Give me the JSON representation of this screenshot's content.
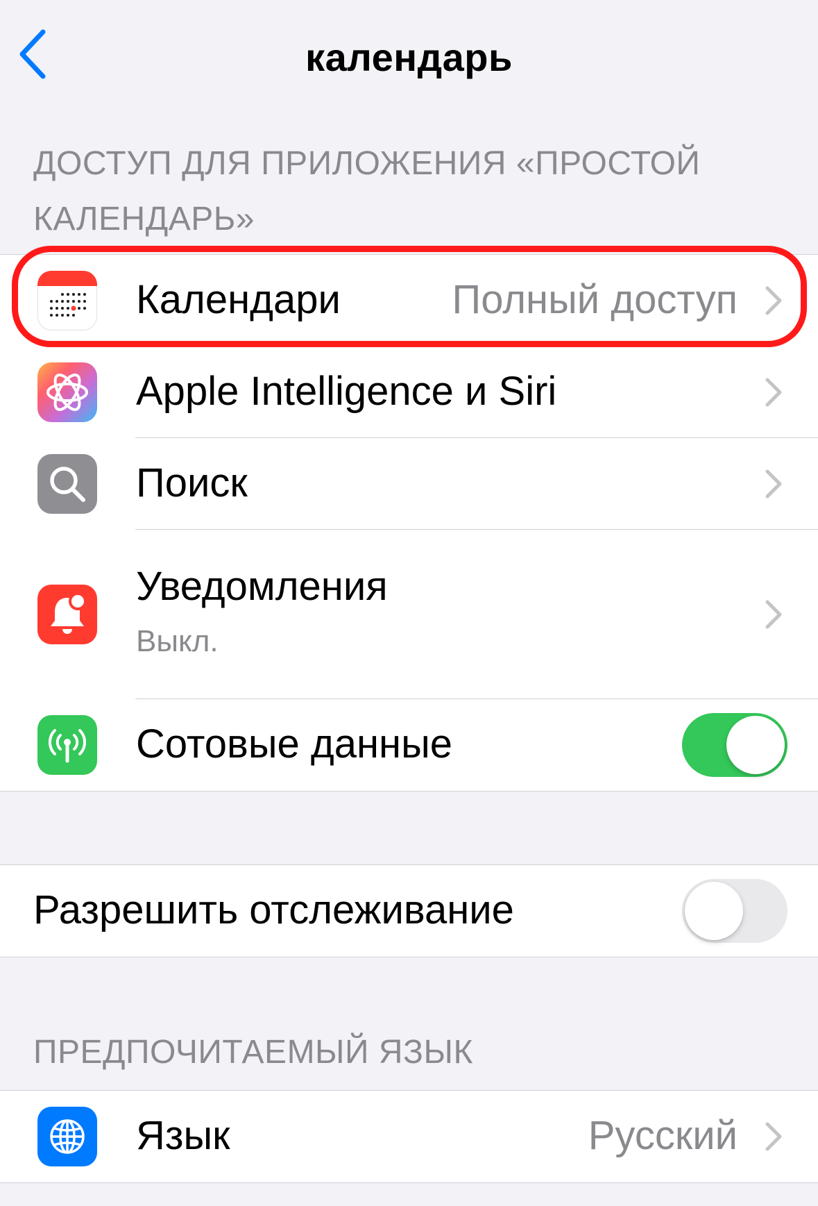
{
  "nav": {
    "title": "календарь",
    "back_icon": "chevron-left-icon"
  },
  "sections": {
    "access_header": "ДОСТУП ДЛЯ ПРИЛОЖЕНИЯ «ПРОСТОЙ КАЛЕНДАРЬ»",
    "language_header": "ПРЕДПОЧИТАЕМЫЙ ЯЗЫК"
  },
  "access": {
    "calendars": {
      "label": "Календари",
      "value": "Полный доступ",
      "icon": "calendar-app-icon"
    },
    "siri": {
      "label": "Apple Intelligence и Siri",
      "icon": "apple-intelligence-icon"
    },
    "search": {
      "label": "Поиск",
      "icon": "search-icon"
    },
    "notifications": {
      "label": "Уведомления",
      "sub": "Выкл.",
      "icon": "notification-bell-icon"
    },
    "cellular": {
      "label": "Сотовые данные",
      "icon": "cellular-antenna-icon",
      "enabled": true
    }
  },
  "tracking": {
    "label": "Разрешить отслеживание",
    "enabled": false
  },
  "language": {
    "label": "Язык",
    "value": "Русский",
    "icon": "globe-icon"
  },
  "colors": {
    "accent": "#007aff",
    "toggle_on": "#34c759",
    "highlight": "#ff1a1a",
    "notifications": "#ff3b30",
    "cellular": "#34c759",
    "search": "#8e8e93"
  }
}
